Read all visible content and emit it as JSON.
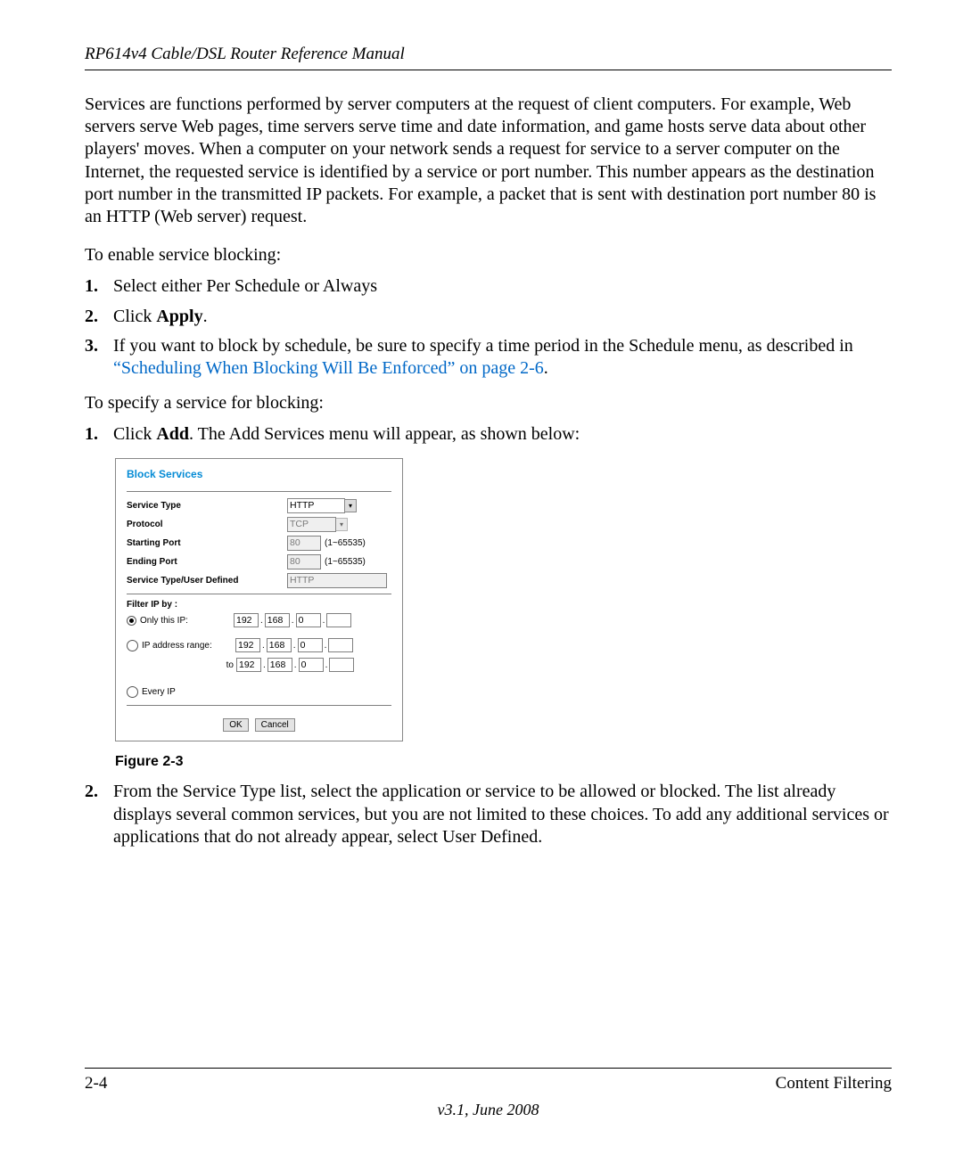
{
  "header": {
    "title": "RP614v4 Cable/DSL Router Reference Manual"
  },
  "intro": "Services are functions performed by server computers at the request of client computers. For example, Web servers serve Web pages, time servers serve time and date information, and game hosts serve data about other players' moves. When a computer on your network sends a request for service to a server computer on the Internet, the requested service is identified by a service or port number. This number appears as the destination port number in the transmitted IP packets. For example, a packet that is sent with destination port number 80 is an HTTP (Web server) request.",
  "enable_lead": "To enable service blocking:",
  "list1": {
    "n1": "1.",
    "t1": "Select either Per Schedule or Always",
    "n2": "2.",
    "t2a": "Click ",
    "t2b": "Apply",
    "t2c": ".",
    "n3": "3.",
    "t3a": "If you want to block by schedule, be sure to specify a time period in the Schedule menu, as described in ",
    "t3link": "“Scheduling When Blocking Will Be Enforced” on page 2-6",
    "t3b": "."
  },
  "specify_lead": "To specify a service for blocking:",
  "list2": {
    "n1": "1.",
    "t1a": "Click ",
    "t1b": "Add",
    "t1c": ". The Add Services menu will appear, as shown below:",
    "n2": "2.",
    "t2": "From the Service Type list, select the application or service to be allowed or blocked. The list already displays several common services, but you are not limited to these choices. To add any additional services or applications that do not already appear, select User Defined."
  },
  "panel": {
    "title": "Block Services",
    "rows": {
      "service_type": {
        "label": "Service Type",
        "value": "HTTP"
      },
      "protocol": {
        "label": "Protocol",
        "value": "TCP"
      },
      "starting_port": {
        "label": "Starting Port",
        "value": "80",
        "hint": "(1~65535)"
      },
      "ending_port": {
        "label": "Ending Port",
        "value": "80",
        "hint": "(1~65535)"
      },
      "user_defined": {
        "label": "Service Type/User Defined",
        "value": "HTTP"
      }
    },
    "filter": {
      "label": "Filter IP by :",
      "only": {
        "label": "Only this IP:",
        "ip": [
          "192",
          "168",
          "0",
          ""
        ]
      },
      "range": {
        "label": "IP address range:",
        "from": [
          "192",
          "168",
          "0",
          ""
        ],
        "to_label": "to",
        "to": [
          "192",
          "168",
          "0",
          ""
        ]
      },
      "every": {
        "label": "Every IP"
      }
    },
    "buttons": {
      "ok": "OK",
      "cancel": "Cancel"
    }
  },
  "figure_caption": "Figure 2-3",
  "footer": {
    "page": "2-4",
    "section": "Content Filtering",
    "version": "v3.1, June 2008"
  }
}
